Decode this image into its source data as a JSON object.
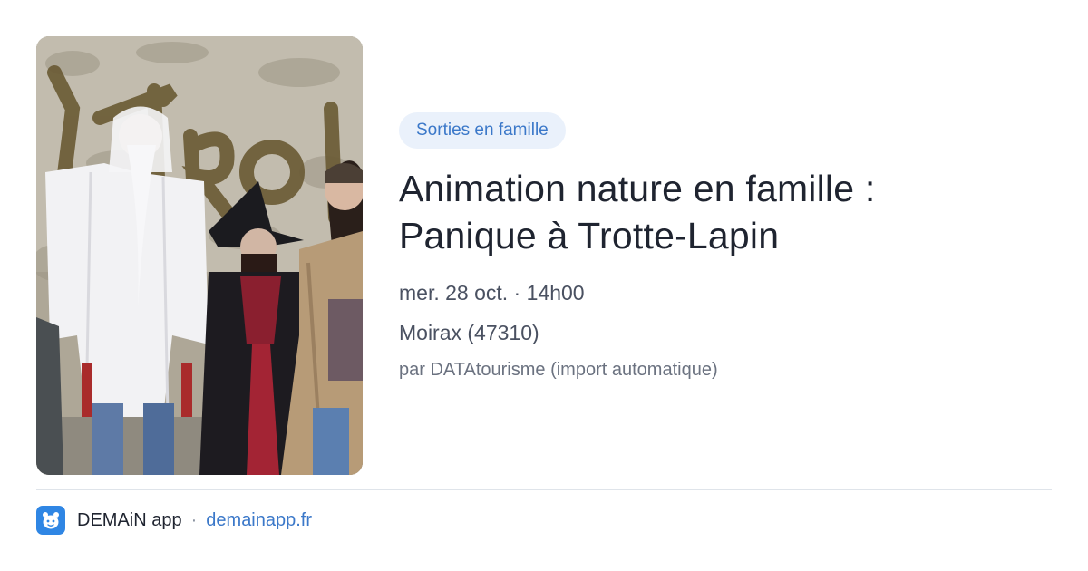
{
  "event": {
    "photo_alt": "Animation nature en famille : Panique à Trotte-Lapin",
    "category": "Sorties en famille",
    "title_line1": "Animation nature en famille :",
    "title_line2": "Panique à Trotte-Lapin",
    "date_time": "mer. 28 oct. · 14h00",
    "place": "Moirax (47310)",
    "source": "par DATAtourisme (import automatique)"
  },
  "footer": {
    "app_icon": "demain-app-icon",
    "app_name": "DEMAiN app",
    "separator": "·",
    "domain": "demainapp.fr"
  },
  "colors": {
    "accent": "#3b78c9",
    "chip_background": "#eaf1fb",
    "app_icon_background": "#2f86e4",
    "divider": "#dfe4ea"
  }
}
